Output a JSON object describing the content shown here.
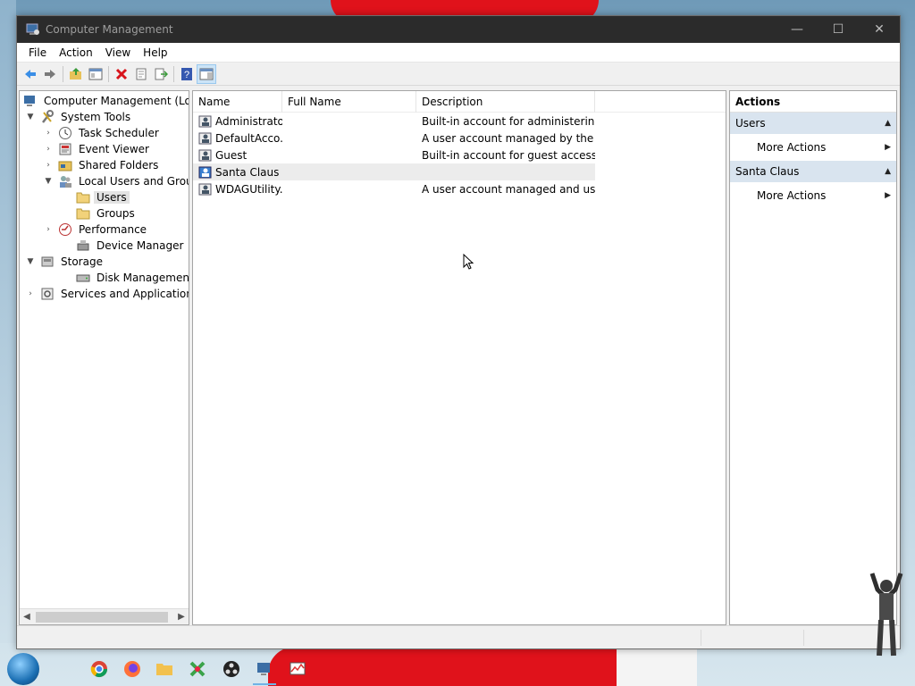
{
  "window": {
    "title": "Computer Management",
    "controls": {
      "minimize": "—",
      "maximize": "☐",
      "close": "✕"
    }
  },
  "menu": [
    "File",
    "Action",
    "View",
    "Help"
  ],
  "tree": {
    "root": "Computer Management (Local",
    "system_tools": "System Tools",
    "task_scheduler": "Task Scheduler",
    "event_viewer": "Event Viewer",
    "shared_folders": "Shared Folders",
    "local_users_groups": "Local Users and Groups",
    "users": "Users",
    "groups": "Groups",
    "performance": "Performance",
    "device_manager": "Device Manager",
    "storage": "Storage",
    "disk_management": "Disk Management",
    "services_apps": "Services and Applications"
  },
  "list": {
    "columns": [
      "Name",
      "Full Name",
      "Description"
    ],
    "rows": [
      {
        "name": "Administrator",
        "full_name": "",
        "description": "Built-in account for administering..."
      },
      {
        "name": "DefaultAcco...",
        "full_name": "",
        "description": "A user account managed by the s..."
      },
      {
        "name": "Guest",
        "full_name": "",
        "description": "Built-in account for guest access t..."
      },
      {
        "name": "Santa Claus",
        "full_name": "",
        "description": ""
      },
      {
        "name": "WDAGUtility...",
        "full_name": "",
        "description": "A user account managed and use..."
      }
    ]
  },
  "actions": {
    "title": "Actions",
    "section1": "Users",
    "more1": "More Actions",
    "section2": "Santa Claus",
    "more2": "More Actions"
  },
  "colors": {
    "section_bg": "#d9e4ef",
    "titlebar_bg": "#2b2b2b",
    "toolbar_active": "#cce4f7"
  }
}
